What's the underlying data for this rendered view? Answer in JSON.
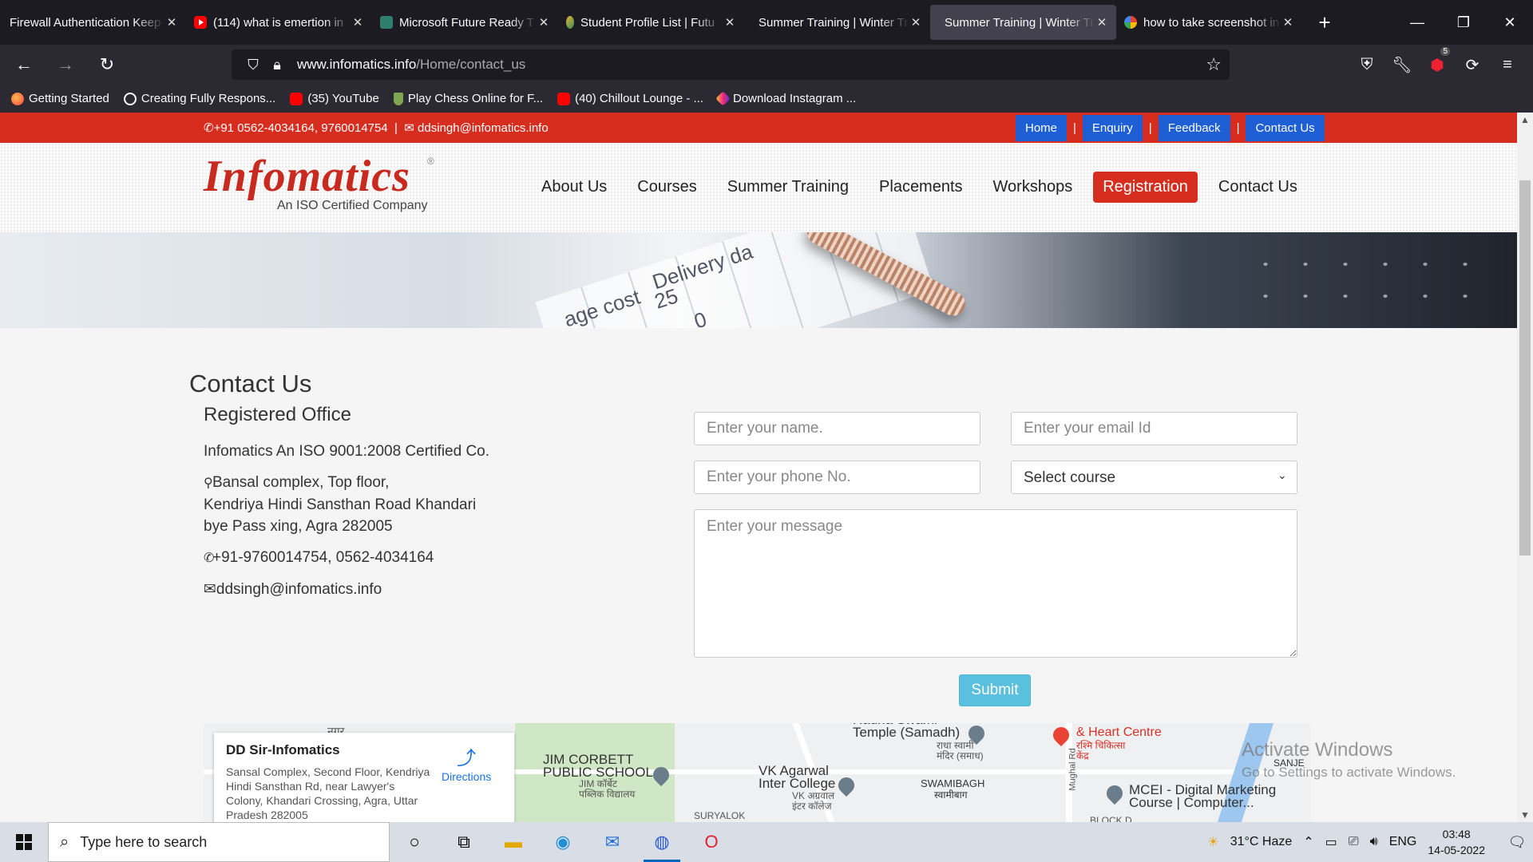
{
  "browser": {
    "tabs": [
      {
        "title": "Firewall Authentication Keep",
        "icon": "none",
        "active": false
      },
      {
        "title": "(114) what is emertion in",
        "icon": "youtube-icon",
        "active": false
      },
      {
        "title": "Microsoft Future Ready T",
        "icon": "microsoft-icon",
        "active": false
      },
      {
        "title": "Student Profile List | Futu",
        "icon": "future-ready-icon",
        "active": false
      },
      {
        "title": "Summer Training | Winter Tra",
        "icon": "none",
        "active": false
      },
      {
        "title": "Summer Training | Winter Tra",
        "icon": "none",
        "active": true
      },
      {
        "title": "how to take screenshot in",
        "icon": "google-icon",
        "active": false
      }
    ],
    "url_domain": "www.infomatics.info",
    "url_path": "/Home/contact_us",
    "extension_badge": "5",
    "bookmarks": [
      {
        "label": "Getting Started",
        "icon": "firefox-icon"
      },
      {
        "label": "Creating Fully Respons...",
        "icon": "globe-icon"
      },
      {
        "label": "(35) YouTube",
        "icon": "youtube-icon"
      },
      {
        "label": "Play Chess Online for F...",
        "icon": "chess-icon"
      },
      {
        "label": "(40) Chillout Lounge - ...",
        "icon": "youtube-icon"
      },
      {
        "label": "Download Instagram ...",
        "icon": "instagram-icon"
      }
    ]
  },
  "site": {
    "topbar": {
      "phone": "+91 0562-4034164, 9760014754",
      "email": "ddsingh@infomatics.info",
      "links": [
        "Home",
        "Enquiry",
        "Feedback",
        "Contact Us"
      ]
    },
    "logo": {
      "name": "Infomatics",
      "tagline": "An ISO Certified Company",
      "reg": "®"
    },
    "nav": [
      "About Us",
      "Courses",
      "Summer Training",
      "Placements",
      "Workshops",
      "Registration",
      "Contact Us"
    ],
    "banner_texts": [
      "age cost",
      "Delivery da",
      "25",
      "0"
    ],
    "contact": {
      "title": "Contact Us",
      "office_heading": "Registered Office",
      "company": "Infomatics An ISO 9001:2008 Certified Co.",
      "address_line1": "Bansal complex, Top floor,",
      "address_line2": "Kendriya Hindi Sansthan Road Khandari",
      "address_line3": "bye Pass xing, Agra 282005",
      "phone": "+91-9760014754, 0562-4034164",
      "email": "ddsingh@infomatics.info"
    },
    "form": {
      "name_placeholder": "Enter your name.",
      "email_placeholder": "Enter your email Id",
      "phone_placeholder": "Enter your phone No.",
      "course_selected": "Select course",
      "message_placeholder": "Enter your message",
      "submit_label": "Submit"
    },
    "map": {
      "place_name": "DD Sir-Infomatics",
      "place_address": "Sansal Complex, Second Floor, Kendriya Hindi Sansthan Rd, near Lawyer's Colony, Khandari Crossing, Agra, Uttar Pradesh 282005",
      "directions_label": "Directions",
      "labels": {
        "nagar": "नगर",
        "jim_corbett": "JIM CORBETT\nPUBLIC SCHOOL",
        "jim_corbett_hi": "JIM कॉर्बेट\nपब्लिक विद्यालय",
        "suryalok": "SURYALOK",
        "vk_agarwal": "VK Agarwal\nInter College",
        "vk_agarwal_hi": "VK अग्रवाल\nइंटर कॉलेज",
        "samadh": "Radha Swami\nTemple (Samadh)",
        "samadh_hi": "राधा स्वामी\nमंदिर (समाध)",
        "swamibagh": "SWAMIBAGH",
        "swamibagh_hi": "स्वामीबाग",
        "rashmi": "Rashmi Medicare\n& Heart Centre",
        "rashmi_hi": "रश्मि चिकित्सा\nकेंद्र",
        "mughal_rd": "Mughal Rd",
        "mcei": "MCEI - Digital Marketing\nCourse | Computer...",
        "block": "BLOCK D",
        "sanjay": "SANJE"
      }
    },
    "watermark": {
      "line1": "Activate Windows",
      "line2": "Go to Settings to activate Windows."
    }
  },
  "taskbar": {
    "search_placeholder": "Type here to search",
    "weather": "31°C  Haze",
    "language": "ENG",
    "time": "03:48",
    "date": "14-05-2022"
  }
}
